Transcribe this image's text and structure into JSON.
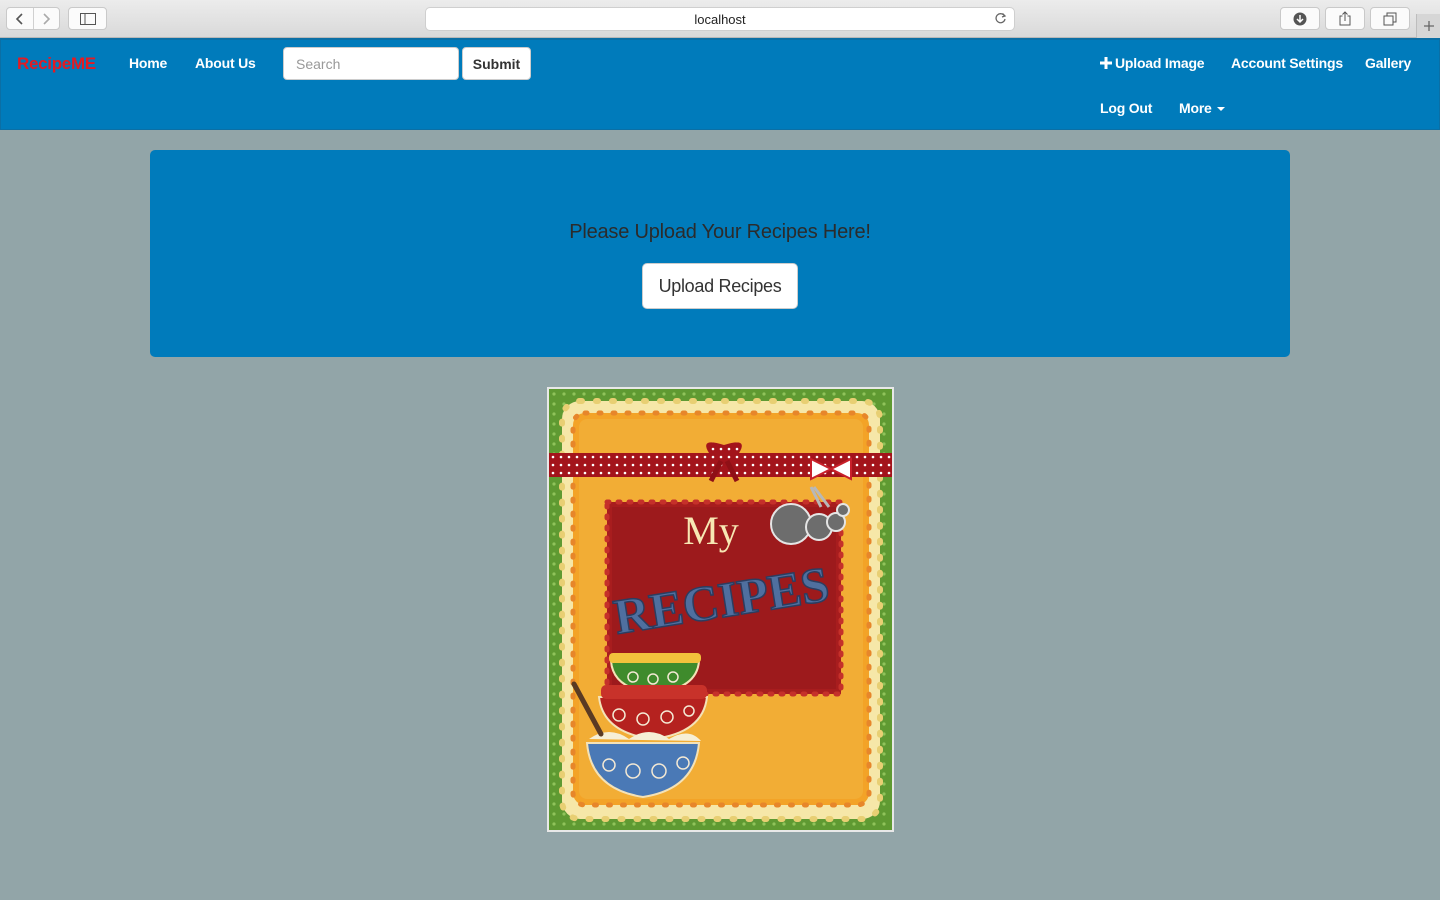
{
  "browser": {
    "url": "localhost",
    "icons": [
      "back-icon",
      "forward-icon",
      "sidebar-icon",
      "reload-icon",
      "download-icon",
      "share-icon",
      "tabs-icon",
      "new-tab-icon"
    ]
  },
  "navbar": {
    "brand": "RecipeME",
    "links": {
      "home": "Home",
      "about": "About Us",
      "upload_image": "Upload Image",
      "account_settings": "Account Settings",
      "gallery": "Gallery",
      "log_out": "Log Out",
      "more": "More"
    },
    "search": {
      "placeholder": "Search",
      "value": ""
    },
    "submit_label": "Submit"
  },
  "jumbotron": {
    "title": "Please Upload Your Recipes Here!",
    "button_label": "Upload Recipes"
  },
  "recipe_card": {
    "title_line1": "My",
    "title_line2": "RECIPES"
  },
  "colors": {
    "primary": "#007bbb",
    "brand": "#e31b23",
    "page_background": "#92a5a8"
  }
}
